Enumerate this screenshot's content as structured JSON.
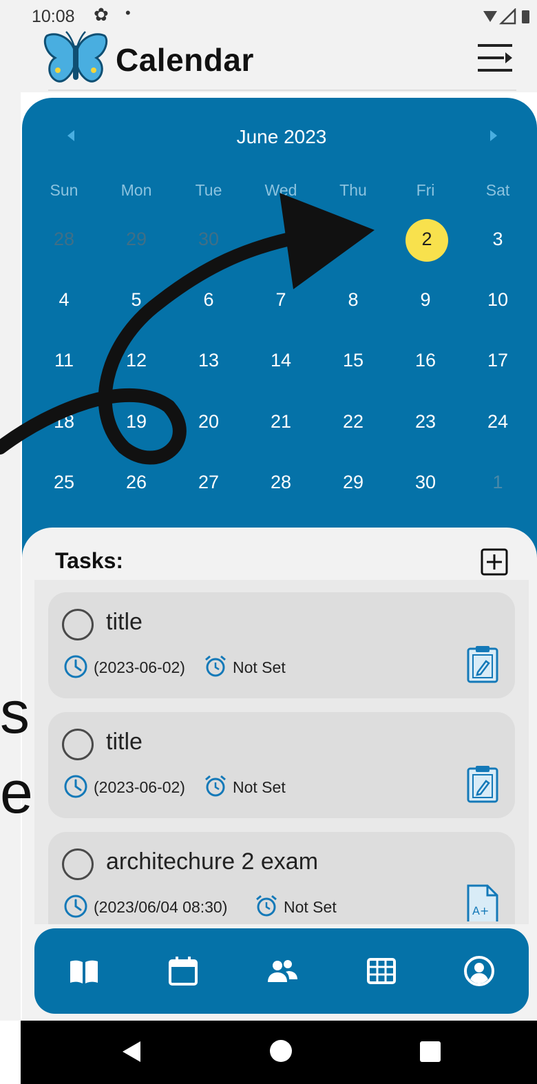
{
  "status_bar": {
    "time": "10:08",
    "settings_glyph": "✿",
    "dot_glyph": "•",
    "icons": [
      "wifi-icon",
      "signal-icon",
      "battery-icon"
    ]
  },
  "app": {
    "title": "Calendar",
    "logo_icon": "butterfly-logo-icon",
    "menu_icon": "menu-icon"
  },
  "calendar": {
    "month_label": "June 2023",
    "weekdays": [
      "Sun",
      "Mon",
      "Tue",
      "Wed",
      "Thu",
      "Fri",
      "Sat"
    ],
    "weeks": [
      [
        "28",
        "29",
        "30",
        "",
        "",
        "2",
        "3"
      ],
      [
        "4",
        "5",
        "6",
        "7",
        "8",
        "9",
        "10"
      ],
      [
        "11",
        "12",
        "13",
        "14",
        "15",
        "16",
        "17"
      ],
      [
        "18",
        "19",
        "20",
        "21",
        "22",
        "23",
        "24"
      ],
      [
        "25",
        "26",
        "27",
        "28",
        "29",
        "30",
        "1"
      ]
    ],
    "selected_day": "2",
    "colors": {
      "panel": "#0572a8",
      "highlight": "#f8e14d"
    }
  },
  "tasks": {
    "heading": "Tasks:",
    "items": [
      {
        "title": "title",
        "date": "(2023-06-02)",
        "alarm": "Not Set",
        "action_icon": "clipboard-edit-icon"
      },
      {
        "title": "title",
        "date": "(2023-06-02)",
        "alarm": "Not Set",
        "action_icon": "clipboard-edit-icon"
      },
      {
        "title": "architechure 2 exam",
        "date": "(2023/06/04 08:30)",
        "alarm": "Not Set",
        "action_icon": "grade-document-icon"
      }
    ]
  },
  "bottom_nav": {
    "items": [
      "book-icon",
      "calendar-icon",
      "group-icon",
      "grid-icon",
      "account-circle-icon"
    ]
  },
  "overlay": {
    "edge_chars": [
      "s",
      "e"
    ]
  }
}
